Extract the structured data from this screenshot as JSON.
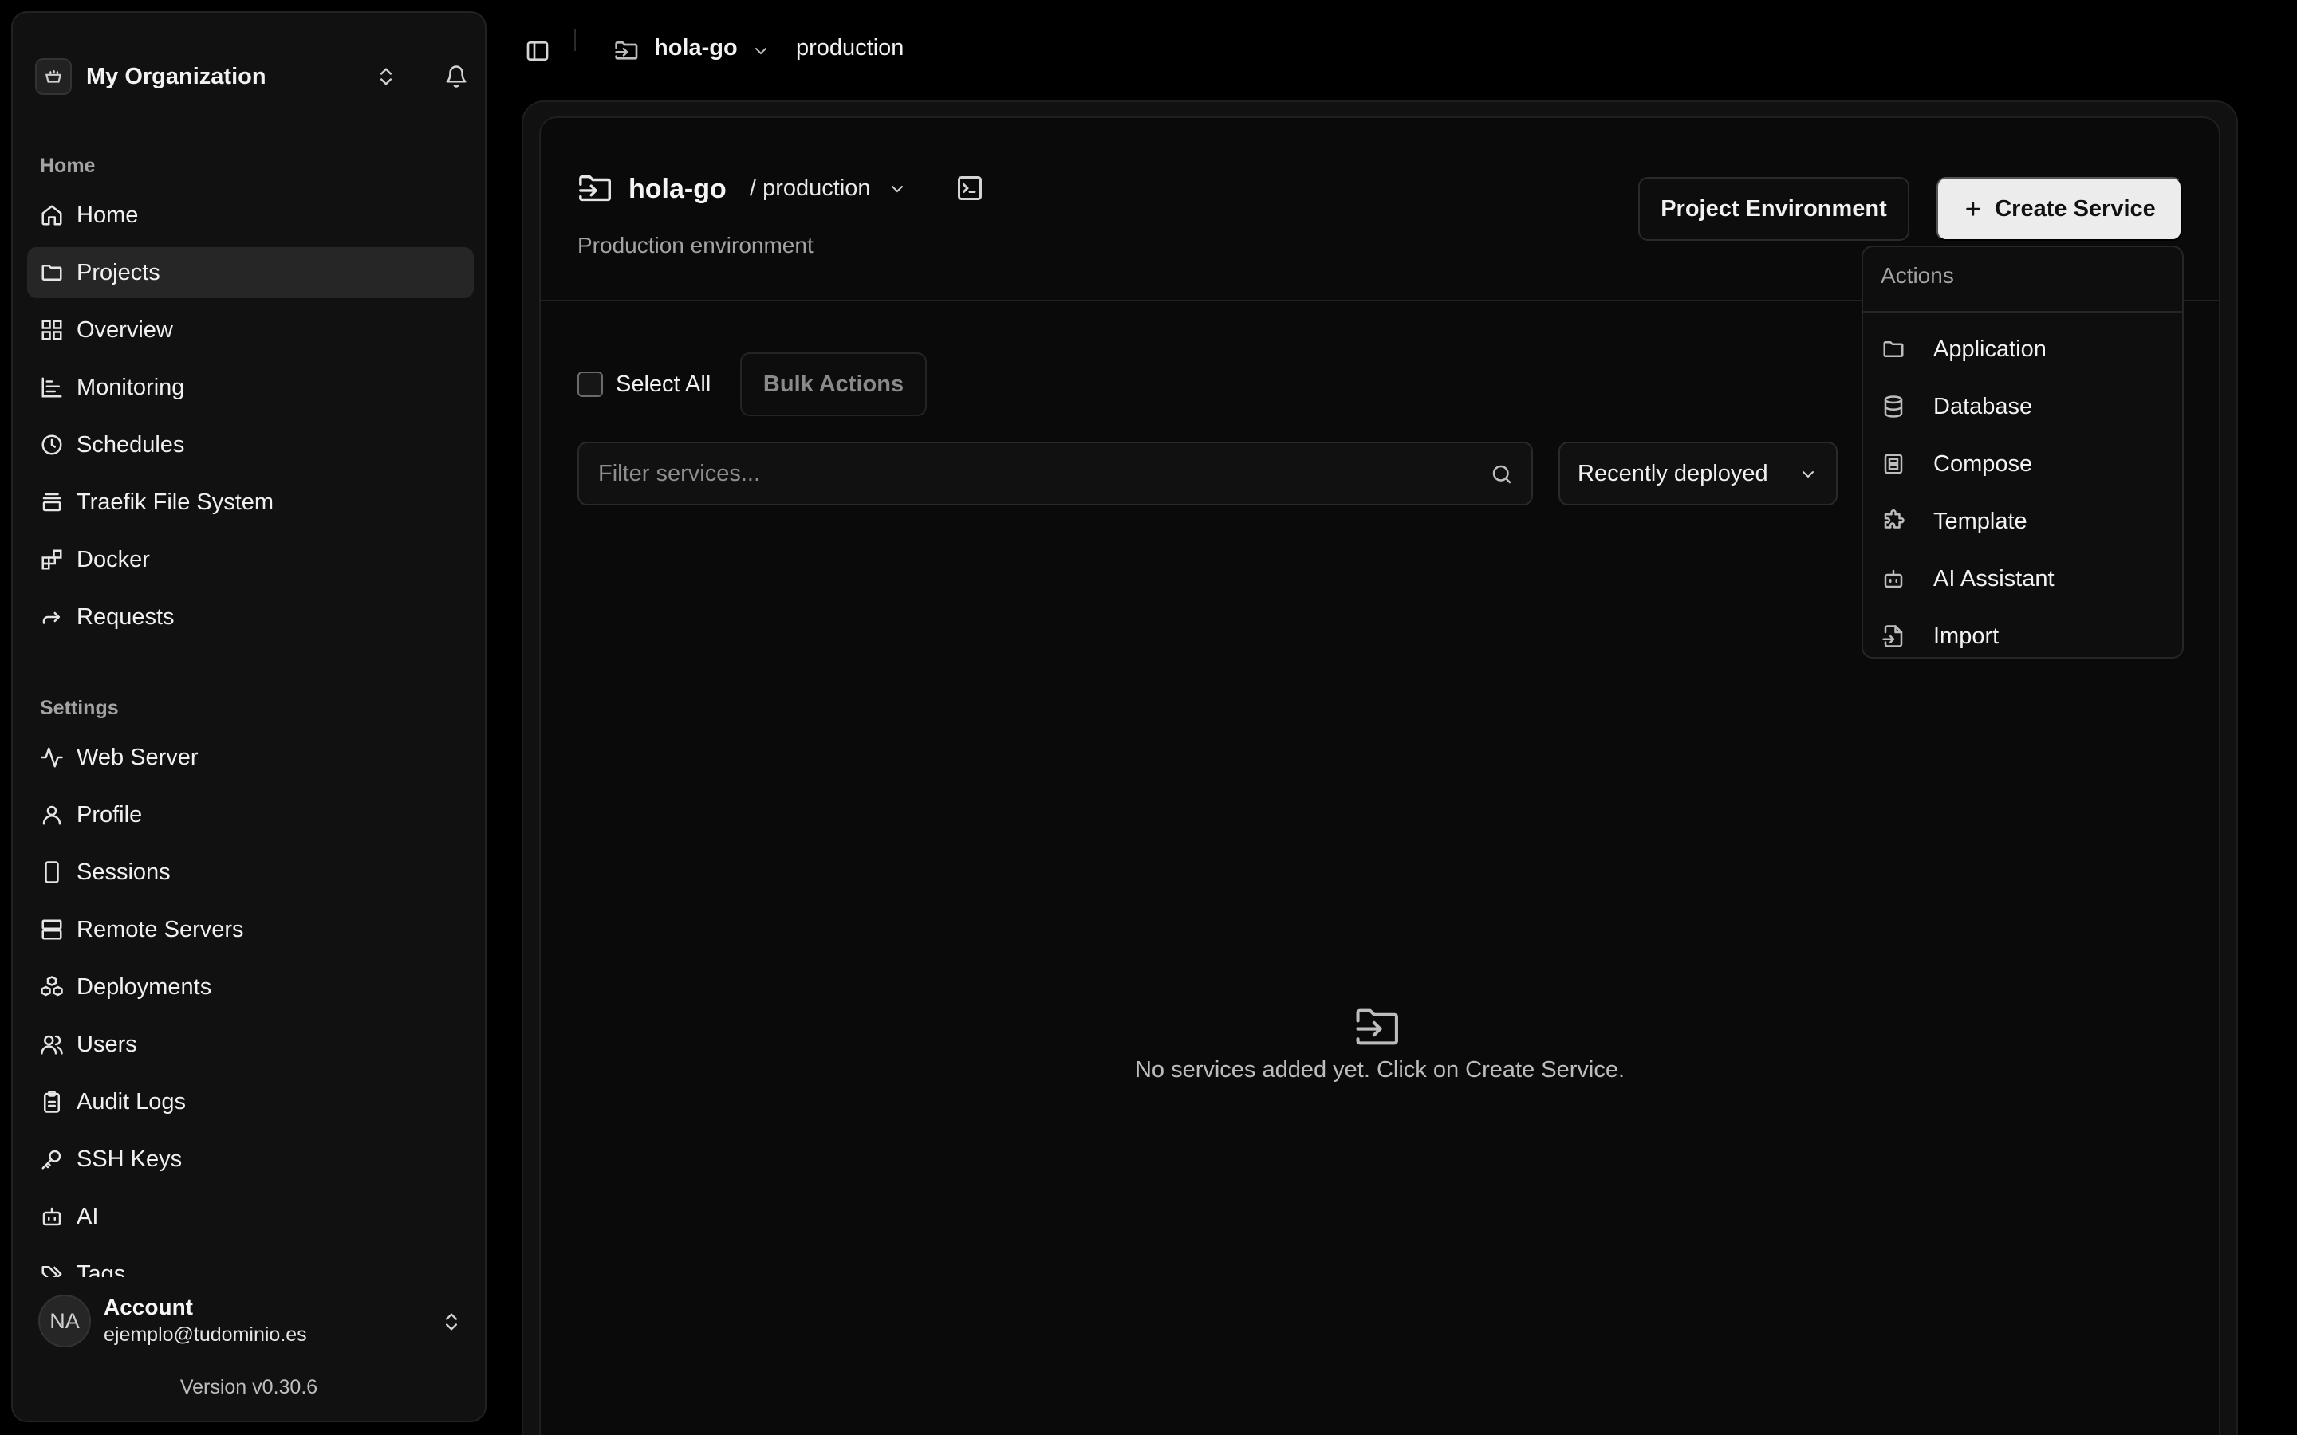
{
  "sidebar": {
    "org_name": "My Organization",
    "section_home": "Home",
    "section_settings": "Settings",
    "home_items": [
      {
        "label": "Home",
        "icon": "home-icon"
      },
      {
        "label": "Projects",
        "icon": "folder-icon"
      },
      {
        "label": "Overview",
        "icon": "grid-icon"
      },
      {
        "label": "Monitoring",
        "icon": "chart-icon"
      },
      {
        "label": "Schedules",
        "icon": "clock-icon"
      },
      {
        "label": "Traefik File System",
        "icon": "stack-icon"
      },
      {
        "label": "Docker",
        "icon": "blocks-icon"
      },
      {
        "label": "Requests",
        "icon": "forward-icon"
      }
    ],
    "settings_items": [
      {
        "label": "Web Server",
        "icon": "activity-icon"
      },
      {
        "label": "Profile",
        "icon": "user-icon"
      },
      {
        "label": "Sessions",
        "icon": "phone-icon"
      },
      {
        "label": "Remote Servers",
        "icon": "server-icon"
      },
      {
        "label": "Deployments",
        "icon": "boxes-icon"
      },
      {
        "label": "Users",
        "icon": "users-icon"
      },
      {
        "label": "Audit Logs",
        "icon": "clipboard-icon"
      },
      {
        "label": "SSH Keys",
        "icon": "key-icon"
      },
      {
        "label": "AI",
        "icon": "bot-icon"
      },
      {
        "label": "Tags",
        "icon": "tags-icon"
      }
    ],
    "active_item": "Projects",
    "account": {
      "initials": "NA",
      "name": "Account",
      "email": "ejemplo@tudominio.es"
    },
    "version": "Version v0.30.6"
  },
  "topbar": {
    "project": "hola-go",
    "environment": "production"
  },
  "project_header": {
    "name": "hola-go",
    "environment": "/ production",
    "description": "Production environment",
    "env_button": "Project Environment",
    "create_button": "Create Service"
  },
  "toolbar": {
    "select_all": "Select All",
    "bulk_actions": "Bulk Actions",
    "filter_placeholder": "Filter services...",
    "sort_value": "Recently deployed"
  },
  "empty_state": {
    "message": "No services added yet. Click on Create Service."
  },
  "dropdown": {
    "title": "Actions",
    "items": [
      {
        "label": "Application",
        "icon": "folder-icon"
      },
      {
        "label": "Database",
        "icon": "database-icon"
      },
      {
        "label": "Compose",
        "icon": "compose-icon"
      },
      {
        "label": "Template",
        "icon": "puzzle-icon"
      },
      {
        "label": "AI Assistant",
        "icon": "bot-icon"
      },
      {
        "label": "Import",
        "icon": "file-import-icon"
      }
    ]
  },
  "colors": {
    "background": "#000000",
    "sidebar": "#111111",
    "card": "#0a0a0a",
    "active_item": "#262626",
    "primary_button": "#ececec"
  }
}
